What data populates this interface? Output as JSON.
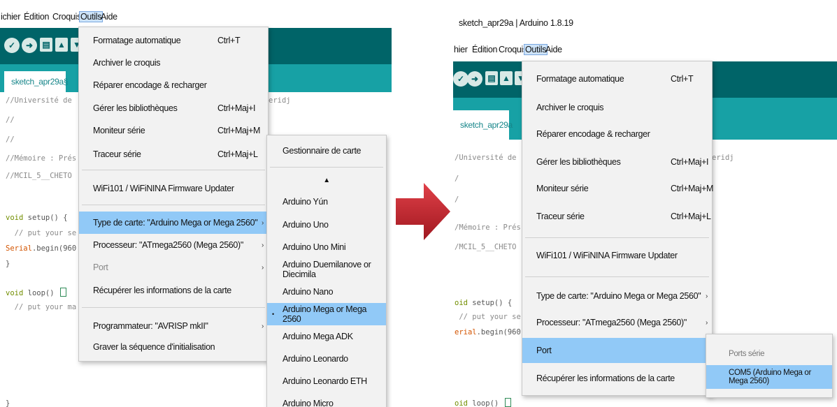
{
  "left": {
    "menubar": [
      "ichier",
      "Édition",
      "Croquis",
      "Outils",
      "Aide"
    ],
    "tab_label": "sketch_apr29a§",
    "code": {
      "l1": "//Université de",
      "l1_tail": "eridj",
      "l2": "//",
      "l3": "//",
      "l4": "//Mémoire : Prés",
      "l5": "//MCIL_5__CHETO",
      "setup_kw": "void",
      "setup_rest": " setup() {",
      "comment1": "  // put your se",
      "serial": "Serial",
      "serial_rest": ".begin(960",
      "brace": "}",
      "loop_kw": "void",
      "loop_rest": " loop() ",
      "comment2": "  // put your ma",
      "last": "}"
    },
    "outils_menu": [
      {
        "label": "Formatage automatique",
        "shortcut": "Ctrl+T"
      },
      {
        "label": "Archiver le croquis",
        "shortcut": ""
      },
      {
        "label": "Réparer encodage & recharger",
        "shortcut": ""
      },
      {
        "label": "Gérer les bibliothèques",
        "shortcut": "Ctrl+Maj+I"
      },
      {
        "label": "Moniteur série",
        "shortcut": "Ctrl+Maj+M"
      },
      {
        "label": "Traceur série",
        "shortcut": "Ctrl+Maj+L"
      },
      {
        "label": "WiFi101 / WiFiNINA Firmware Updater",
        "shortcut": ""
      },
      {
        "label": "Type de carte: \"Arduino Mega or Mega 2560\"",
        "shortcut": ""
      },
      {
        "label": "Processeur: \"ATmega2560 (Mega 2560)\"",
        "shortcut": ""
      },
      {
        "label": "Port",
        "shortcut": ""
      },
      {
        "label": "Récupérer les informations de la carte",
        "shortcut": ""
      },
      {
        "label": "Programmateur: \"AVRISP mkII\"",
        "shortcut": ""
      },
      {
        "label": "Graver la séquence d'initialisation",
        "shortcut": ""
      }
    ],
    "board_submenu": {
      "header": "Gestionnaire de carte",
      "scroll_up": "▲",
      "items": [
        "Arduino Yún",
        "Arduino Uno",
        "Arduino Uno Mini",
        "Arduino Duemilanove or Diecimila",
        "Arduino Nano",
        "Arduino Mega or Mega 2560",
        "Arduino Mega ADK",
        "Arduino Leonardo",
        "Arduino Leonardo ETH",
        "Arduino Micro"
      ],
      "selected_marker": "•"
    }
  },
  "right": {
    "window_title": "sketch_apr29a | Arduino 1.8.19",
    "menubar": [
      "hier",
      "Édition",
      "Croquis",
      "Outils",
      "Aide"
    ],
    "tab_label": "sketch_apr29a",
    "code": {
      "l1": "/Université de",
      "l1_tail": "eridj",
      "l2": "/",
      "l3": "/",
      "l4": "/Mémoire : Prés",
      "l5": "/MCIL_5__CHETO",
      "setup_kw": "oid",
      "setup_rest": " setup() {",
      "comment1": " // put your se",
      "serial": "erial",
      "serial_rest": ".begin(960",
      "loop_kw": "oid",
      "loop_rest": " loop() "
    },
    "outils_menu": [
      {
        "label": "Formatage automatique",
        "shortcut": "Ctrl+T"
      },
      {
        "label": "Archiver le croquis",
        "shortcut": ""
      },
      {
        "label": "Réparer encodage & recharger",
        "shortcut": ""
      },
      {
        "label": "Gérer les bibliothèques",
        "shortcut": "Ctrl+Maj+I"
      },
      {
        "label": "Moniteur série",
        "shortcut": "Ctrl+Maj+M"
      },
      {
        "label": "Traceur série",
        "shortcut": "Ctrl+Maj+L"
      },
      {
        "label": "WiFi101 / WiFiNINA Firmware Updater",
        "shortcut": ""
      },
      {
        "label": "Type de carte: \"Arduino Mega or Mega 2560\"",
        "shortcut": ""
      },
      {
        "label": "Processeur: \"ATmega2560 (Mega 2560)\"",
        "shortcut": ""
      },
      {
        "label": "Port",
        "shortcut": ""
      },
      {
        "label": "Récupérer les informations de la carte",
        "shortcut": ""
      }
    ],
    "port_submenu": {
      "header": "Ports série",
      "item": "COM5 (Arduino Mega or Mega 2560)"
    }
  },
  "colors": {
    "toolbar": "#006468",
    "tabbar": "#17a1a5",
    "highlight": "#91c9f7",
    "arrow": "#c0262c"
  },
  "icons": [
    "verify-icon",
    "upload-icon",
    "new-icon",
    "open-icon",
    "save-icon",
    "submenu-arrow-icon",
    "transition-arrow-icon"
  ]
}
